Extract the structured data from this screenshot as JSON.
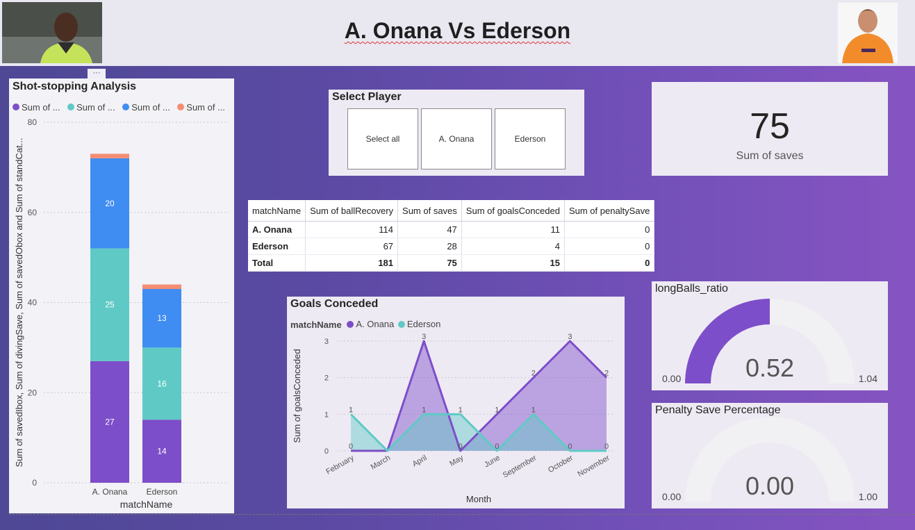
{
  "header": {
    "title": "A. Onana Vs Ederson",
    "left_photo": "A. Onana photo",
    "right_photo": "Ederson photo"
  },
  "shot_chart": {
    "title": "Shot-stopping Analysis",
    "legend": [
      "Sum of ...",
      "Sum of ...",
      "Sum of ...",
      "Sum of ..."
    ],
    "more_icon": "···",
    "chart_data": {
      "type": "bar",
      "title": "Shot-stopping Analysis",
      "xlabel": "matchName",
      "ylabel": "Sum of savedIbox, Sum of divingSave, Sum of savedObox and Sum of standCat...",
      "categories": [
        "A. Onana",
        "Ederson"
      ],
      "ylim": [
        0,
        80
      ],
      "yticks": [
        "0",
        "20",
        "40",
        "60",
        "80"
      ],
      "stacked": true,
      "series": [
        {
          "values": [
            27,
            14
          ],
          "labels": [
            "27",
            "14"
          ],
          "color": "#7d4ec9"
        },
        {
          "values": [
            25,
            16
          ],
          "labels": [
            "25",
            "16"
          ],
          "color": "#5fcac5"
        },
        {
          "values": [
            20,
            13
          ],
          "labels": [
            "20",
            "13"
          ],
          "color": "#3f8cf2"
        },
        {
          "values": [
            1,
            1
          ],
          "labels": [
            "",
            ""
          ],
          "color": "#f58d72"
        }
      ]
    }
  },
  "slicer": {
    "title": "Select Player",
    "options": [
      "Select all",
      "A. Onana",
      "Ederson"
    ]
  },
  "kpi": {
    "value": "75",
    "label": "Sum of saves"
  },
  "table": {
    "headers": [
      "matchName",
      "Sum of ballRecovery",
      "Sum of saves",
      "Sum of goalsConceded",
      "Sum of penaltySave"
    ],
    "rows": [
      [
        "A. Onana",
        "114",
        "47",
        "11",
        "0"
      ],
      [
        "Ederson",
        "67",
        "28",
        "4",
        "0"
      ]
    ],
    "total": [
      "Total",
      "181",
      "75",
      "15",
      "0"
    ]
  },
  "goals_chart": {
    "title": "Goals Conceded",
    "legend_title": "matchName",
    "legend": [
      "A. Onana",
      "Ederson"
    ],
    "chart_data": {
      "type": "area",
      "title": "Goals Conceded",
      "xlabel": "Month",
      "ylabel": "Sum of goalsConceded",
      "categories": [
        "February",
        "March",
        "April",
        "May",
        "June",
        "September",
        "October",
        "November"
      ],
      "ylim": [
        0,
        3
      ],
      "yticks": [
        "0",
        "1",
        "2",
        "3"
      ],
      "series": [
        {
          "name": "A. Onana",
          "values": [
            0,
            0,
            3,
            0,
            1,
            2,
            3,
            2
          ],
          "color": "#7d4ec9"
        },
        {
          "name": "Ederson",
          "values": [
            1,
            0,
            1,
            1,
            0,
            1,
            0,
            0
          ],
          "color": "#5fcac5"
        }
      ],
      "data_labels": [
        {
          "text": "0",
          "series": 0,
          "index": 0
        },
        {
          "text": "1",
          "series": 1,
          "index": 0
        },
        {
          "text": "3",
          "series": 0,
          "index": 2
        },
        {
          "text": "1",
          "series": 1,
          "index": 2
        },
        {
          "text": "0",
          "series": 0,
          "index": 3
        },
        {
          "text": "1",
          "series": 1,
          "index": 3
        },
        {
          "text": "1",
          "series": 0,
          "index": 4
        },
        {
          "text": "0",
          "series": 1,
          "index": 4
        },
        {
          "text": "2",
          "series": 0,
          "index": 5
        },
        {
          "text": "1",
          "series": 1,
          "index": 5
        },
        {
          "text": "3",
          "series": 0,
          "index": 6
        },
        {
          "text": "0",
          "series": 1,
          "index": 6
        },
        {
          "text": "2",
          "series": 0,
          "index": 7
        },
        {
          "text": "0",
          "series": 1,
          "index": 7
        }
      ]
    }
  },
  "gauge_longballs": {
    "title": "longBalls_ratio",
    "value": "0.52",
    "min": "0.00",
    "max": "1.04",
    "fraction": 0.5,
    "color": "#7d4ec9"
  },
  "gauge_penalty": {
    "title": "Penalty Save Percentage",
    "value": "0.00",
    "min": "0.00",
    "max": "1.00",
    "fraction": 0
  }
}
